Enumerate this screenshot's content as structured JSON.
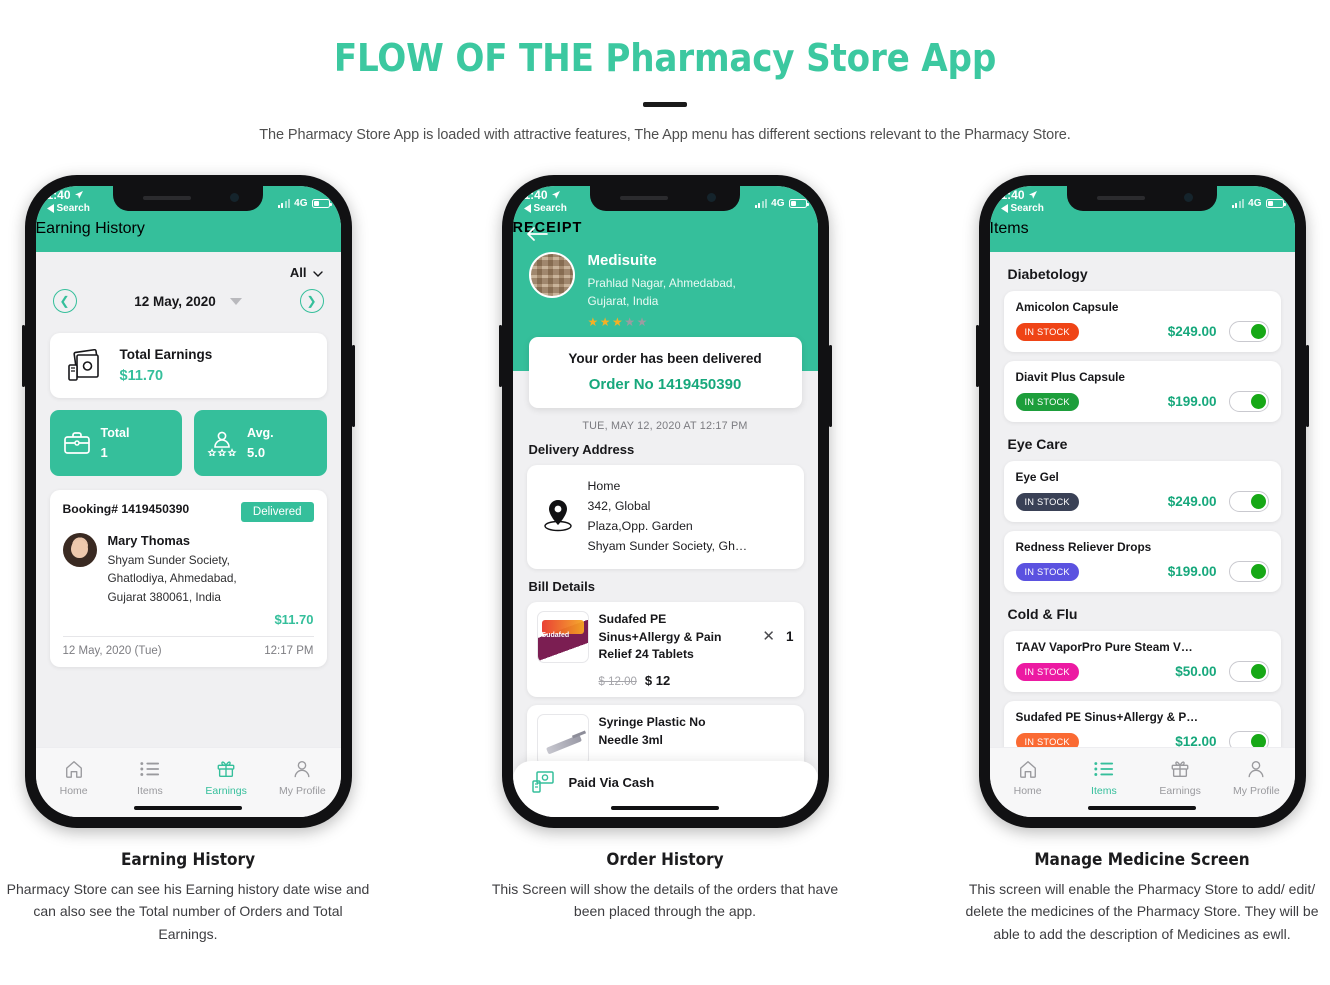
{
  "hero": {
    "title": "FLOW OF THE Pharmacy Store App",
    "subtitle": "The Pharmacy Store App is loaded with attractive features, The App menu has different sections relevant to the Pharmacy Store."
  },
  "colors": {
    "brand_green": "#35bf9b",
    "accent_green": "#17a87c",
    "title_green": "#3cc8a0",
    "toggle_on": "#17a817",
    "star_on": "#f5b024",
    "star_off": "#9c9ca1"
  },
  "status_bar": {
    "time": "1:40",
    "back_label": "Search",
    "network": "4G"
  },
  "tabs": [
    {
      "label": "Home",
      "icon": "home-icon"
    },
    {
      "label": "Items",
      "icon": "list-icon"
    },
    {
      "label": "Earnings",
      "icon": "gift-icon"
    },
    {
      "label": "My Profile",
      "icon": "person-icon"
    }
  ],
  "screen1": {
    "title": "Earning History",
    "filter": "All",
    "date": "12 May, 2020",
    "total_earnings_label": "Total Earnings",
    "total_earnings_value": "$11.70",
    "stats": [
      {
        "label": "Total",
        "value": "1",
        "icon": "briefcase-icon"
      },
      {
        "label": "Avg.",
        "value": "5.0",
        "icon": "rating-person-icon"
      }
    ],
    "booking": {
      "id_label": "Booking# 1419450390",
      "status": "Delivered",
      "customer": "Mary Thomas",
      "address": "Shyam Sunder Society,\nGhatlodiya,  Ahmedabad,\nGujarat 380061,  India",
      "amount": "$11.70",
      "date": "12 May, 2020 (Tue)",
      "time": "12:17 PM"
    },
    "active_tab": "Earnings",
    "caption_title": "Earning History",
    "caption_body": "Pharmacy Store can see his Earning history date wise and can also see the Total number of Orders and Total Earnings."
  },
  "screen2": {
    "title": "RECEIPT",
    "store": {
      "name": "Medisuite",
      "address": "Prahlad Nagar, Ahmedabad,\nGujarat, India",
      "rating_filled": 3,
      "rating_total": 5
    },
    "order_status": "Your order has been delivered",
    "order_no": "Order No 1419450390",
    "timestamp": "TUE, MAY 12, 2020 AT 12:17 PM",
    "delivery_address_heading": "Delivery Address",
    "delivery_address": {
      "label": "Home",
      "line1": "342, Global",
      "line2": "Plaza,Opp. Garden",
      "line3": "Shyam Sunder Society,  Gh…"
    },
    "bill_details_heading": "Bill Details",
    "bill_items": [
      {
        "name": "Sudafed PE\nSinus+Allergy & Pain\nRelief 24 Tablets",
        "old_price": "$ 12.00",
        "price": "$ 12",
        "qty": "1",
        "thumb": "sudafed-box-image"
      },
      {
        "name": "Syringe Plastic No\nNeedle 3ml",
        "old_price": "",
        "price": "",
        "qty": "",
        "thumb": "syringe-image"
      }
    ],
    "paid_via": "Paid Via Cash",
    "caption_title": "Order History",
    "caption_body": "This Screen will show the details of the orders that have been placed through the app."
  },
  "screen3": {
    "title": "Items",
    "active_tab": "Items",
    "categories": [
      {
        "name": "Diabetology",
        "items": [
          {
            "name": "Amicolon Capsule",
            "stock": "IN STOCK",
            "stock_color": "#ef4416",
            "price": "$249.00",
            "toggle": true
          },
          {
            "name": "Diavit Plus Capsule",
            "stock": "IN STOCK",
            "stock_color": "#1d9e3b",
            "price": "$199.00",
            "toggle": true
          }
        ]
      },
      {
        "name": "Eye Care",
        "items": [
          {
            "name": "Eye Gel",
            "stock": "IN STOCK",
            "stock_color": "#3a4156",
            "price": "$249.00",
            "toggle": true
          },
          {
            "name": "Redness Reliever Drops",
            "stock": "IN STOCK",
            "stock_color": "#5b52e0",
            "price": "$199.00",
            "toggle": true
          }
        ]
      },
      {
        "name": "Cold & Flu",
        "items": [
          {
            "name": "TAAV VaporPro Pure Steam V…",
            "stock": "IN STOCK",
            "stock_color": "#ec1aa2",
            "price": "$50.00",
            "toggle": true
          },
          {
            "name": "Sudafed PE Sinus+Allergy & P…",
            "stock": "IN STOCK",
            "stock_color": "#fa6a33",
            "price": "$12.00",
            "toggle": true
          }
        ]
      }
    ],
    "caption_title": "Manage Medicine Screen",
    "caption_body": "This screen will enable the Pharmacy Store to add/ edit/ delete the medicines of the Pharmacy Store. They will be able to add the description of Medicines as ewll."
  }
}
